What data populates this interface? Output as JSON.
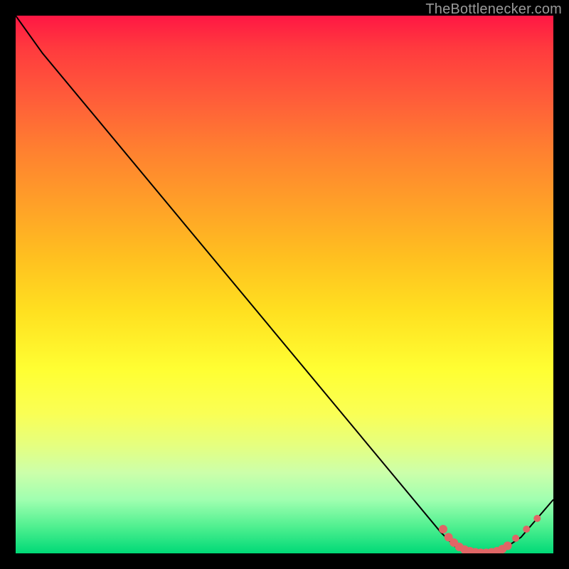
{
  "attribution": "TheBottlenecker.com",
  "chart_data": {
    "type": "line",
    "title": "",
    "xlabel": "",
    "ylabel": "",
    "xlim": [
      0,
      100
    ],
    "ylim": [
      0,
      100
    ],
    "series": [
      {
        "name": "bottleneck-curve",
        "x": [
          0,
          5,
          79,
          82,
          85,
          88,
          91,
          94,
          100
        ],
        "y": [
          100,
          93,
          4,
          1,
          0,
          0,
          1,
          3,
          10
        ]
      }
    ],
    "markers": {
      "name": "optimal-zone-dots",
      "color": "#e06666",
      "points": [
        {
          "x": 79.5,
          "y": 4.5
        },
        {
          "x": 80.5,
          "y": 3.0
        },
        {
          "x": 81.5,
          "y": 2.0
        },
        {
          "x": 82.5,
          "y": 1.2
        },
        {
          "x": 83.5,
          "y": 0.7
        },
        {
          "x": 84.5,
          "y": 0.4
        },
        {
          "x": 85.5,
          "y": 0.2
        },
        {
          "x": 86.5,
          "y": 0.1
        },
        {
          "x": 87.5,
          "y": 0.1
        },
        {
          "x": 88.5,
          "y": 0.2
        },
        {
          "x": 89.5,
          "y": 0.4
        },
        {
          "x": 90.5,
          "y": 0.8
        },
        {
          "x": 91.5,
          "y": 1.4
        },
        {
          "x": 93.0,
          "y": 2.8
        },
        {
          "x": 95.0,
          "y": 4.5
        },
        {
          "x": 97.0,
          "y": 6.5
        }
      ]
    }
  }
}
